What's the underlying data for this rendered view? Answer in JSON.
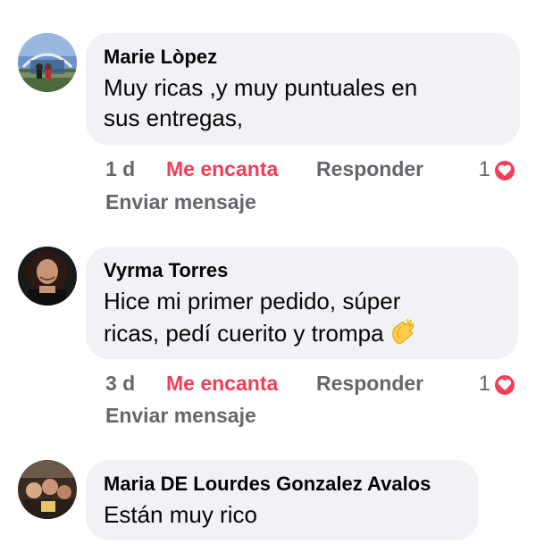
{
  "comments": [
    {
      "author": "Marie Lòpez",
      "lines": [
        "Muy ricas ,y muy puntuales en",
        "sus entregas,"
      ],
      "time": "1 d",
      "love_label": "Me encanta",
      "reply_label": "Responder",
      "reaction_count": "1",
      "send_message_label": "Enviar mensaje"
    },
    {
      "author": "Vyrma Torres",
      "lines": [
        "Hice mi primer pedido, súper",
        "ricas, pedí cuerito y trompa"
      ],
      "emoji_icon": "clapping-hands-icon",
      "time": "3 d",
      "love_label": "Me encanta",
      "reply_label": "Responder",
      "reaction_count": "1",
      "send_message_label": "Enviar mensaje"
    },
    {
      "author": "Maria DE Lourdes Gonzalez Avalos",
      "lines": [
        "Están muy rico"
      ]
    }
  ],
  "colors": {
    "bubble_bg": "#f0f2f5",
    "love_red": "#f33e58",
    "secondary_text": "#65676b"
  }
}
